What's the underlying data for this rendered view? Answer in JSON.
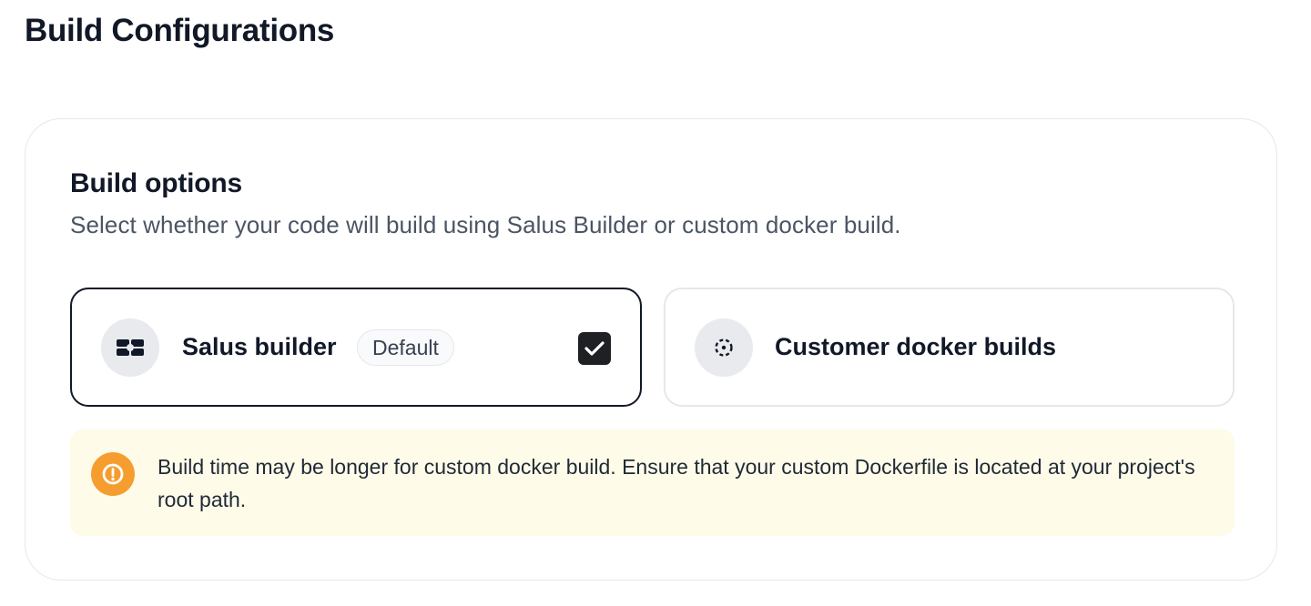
{
  "header": {
    "title": "Build Configurations"
  },
  "build_options": {
    "title": "Build options",
    "description": "Select whether your code will build using Salus Builder or custom docker build.",
    "options": [
      {
        "label": "Salus builder",
        "badge": "Default",
        "selected": true,
        "icon": "salus-builder-icon"
      },
      {
        "label": "Customer docker builds",
        "selected": false,
        "icon": "docker-build-icon"
      }
    ]
  },
  "alert": {
    "icon": "warning-circle-icon",
    "text": "Build time may be longer for custom docker build. Ensure that your custom Dockerfile is located at your project's root path."
  },
  "colors": {
    "selected_border": "#111827",
    "unselected_border": "#e5e7eb",
    "checkbox": "#1f2024",
    "alert_background": "#fefbe8",
    "alert_icon": "#f59e2f"
  }
}
